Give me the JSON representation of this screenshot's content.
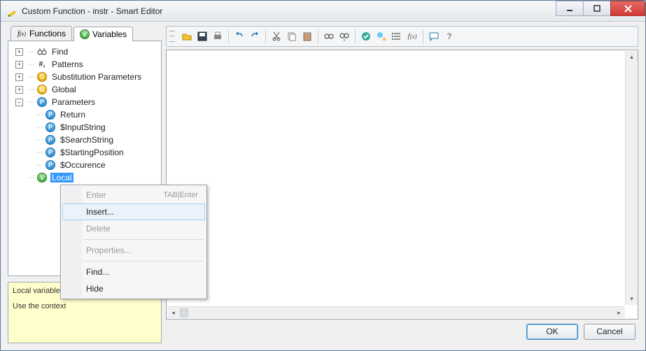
{
  "window": {
    "title": "Custom Function - instr - Smart Editor"
  },
  "tabs": {
    "functions": {
      "label": "Functions",
      "icon": "fx"
    },
    "variables": {
      "label": "Variables",
      "icon": "V"
    }
  },
  "tree": {
    "find": {
      "label": "Find"
    },
    "patterns": {
      "label": "Patterns"
    },
    "subst": {
      "label": "Substitution Parameters"
    },
    "global": {
      "label": "Global"
    },
    "parameters": {
      "label": "Parameters",
      "children": {
        "return": {
          "label": "Return"
        },
        "input": {
          "label": "$InputString"
        },
        "search": {
          "label": "$SearchString"
        },
        "startpos": {
          "label": "$StartingPosition"
        },
        "occur": {
          "label": "$Occurence"
        }
      }
    },
    "local": {
      "label": "Local"
    }
  },
  "help": {
    "line1": "Local variables",
    "line2": "Use the context"
  },
  "context_menu": {
    "enter": {
      "label": "Enter",
      "shortcut": "TAB|Enter"
    },
    "insert": {
      "label": "Insert..."
    },
    "delete": {
      "label": "Delete"
    },
    "properties": {
      "label": "Properties..."
    },
    "find": {
      "label": "Find..."
    },
    "hide": {
      "label": "Hide"
    }
  },
  "toolbar": {
    "open": "open",
    "save": "save",
    "print": "print",
    "undo": "undo",
    "redo": "redo",
    "cut": "cut",
    "copy": "copy",
    "paste": "paste",
    "find": "find",
    "findvar": "find-variable",
    "validate": "validate",
    "highlight": "highlight",
    "list": "list",
    "fx": "fx",
    "comment": "comment",
    "help": "help"
  },
  "buttons": {
    "ok": "OK",
    "cancel": "Cancel"
  }
}
